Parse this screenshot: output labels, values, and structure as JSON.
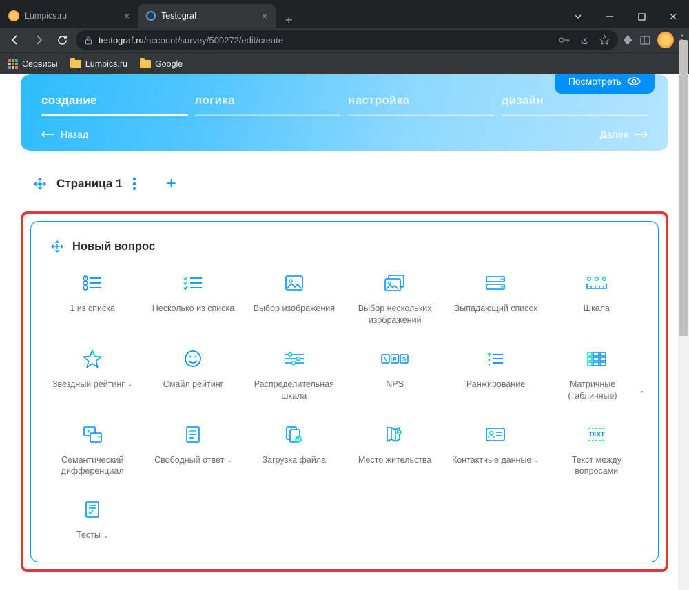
{
  "browser": {
    "tabs": [
      {
        "title": "Lumpics.ru",
        "active": false
      },
      {
        "title": "Testograf",
        "active": true
      }
    ],
    "url_domain": "testograf.ru",
    "url_path": "/account/survey/500272/edit/create"
  },
  "bookmarks": [
    {
      "label": "Сервисы",
      "type": "apps"
    },
    {
      "label": "Lumpics.ru",
      "type": "folder"
    },
    {
      "label": "Google",
      "type": "folder"
    }
  ],
  "hero": {
    "preview_label": "Посмотреть",
    "steps": [
      {
        "label": "создание",
        "active": true
      },
      {
        "label": "логика",
        "active": false
      },
      {
        "label": "настройка",
        "active": false
      },
      {
        "label": "дизайн",
        "active": false
      }
    ],
    "back": "Назад",
    "next": "Далее"
  },
  "page_section": {
    "title": "Страница 1"
  },
  "question_panel": {
    "title": "Новый вопрос",
    "types": [
      {
        "label": "1 из списка",
        "icon": "radio-list",
        "dropdown": false
      },
      {
        "label": "Несколько из списка",
        "icon": "check-list",
        "dropdown": false
      },
      {
        "label": "Выбор изображения",
        "icon": "image",
        "dropdown": false
      },
      {
        "label": "Выбор нескольких изображений",
        "icon": "images",
        "dropdown": false
      },
      {
        "label": "Выпадающий список",
        "icon": "dropdown",
        "dropdown": false
      },
      {
        "label": "Шкала",
        "icon": "scale",
        "dropdown": false
      },
      {
        "label": "Звездный рейтинг",
        "icon": "star",
        "dropdown": true
      },
      {
        "label": "Смайл рейтинг",
        "icon": "smile",
        "dropdown": false
      },
      {
        "label": "Распределительная шкала",
        "icon": "sliders",
        "dropdown": false
      },
      {
        "label": "NPS",
        "icon": "nps",
        "dropdown": false
      },
      {
        "label": "Ранжирование",
        "icon": "rank",
        "dropdown": false
      },
      {
        "label": "Матричные (табличные)",
        "icon": "matrix",
        "dropdown": true
      },
      {
        "label": "Семантический дифференциал",
        "icon": "semantic",
        "dropdown": false
      },
      {
        "label": "Свободный ответ",
        "icon": "free-text",
        "dropdown": true
      },
      {
        "label": "Загрузка файла",
        "icon": "upload",
        "dropdown": false
      },
      {
        "label": "Место жительства",
        "icon": "location",
        "dropdown": false
      },
      {
        "label": "Контактные данные",
        "icon": "contact",
        "dropdown": true
      },
      {
        "label": "Текст между вопросами",
        "icon": "text-block",
        "dropdown": false
      },
      {
        "label": "Тесты",
        "icon": "test",
        "dropdown": true
      }
    ]
  }
}
